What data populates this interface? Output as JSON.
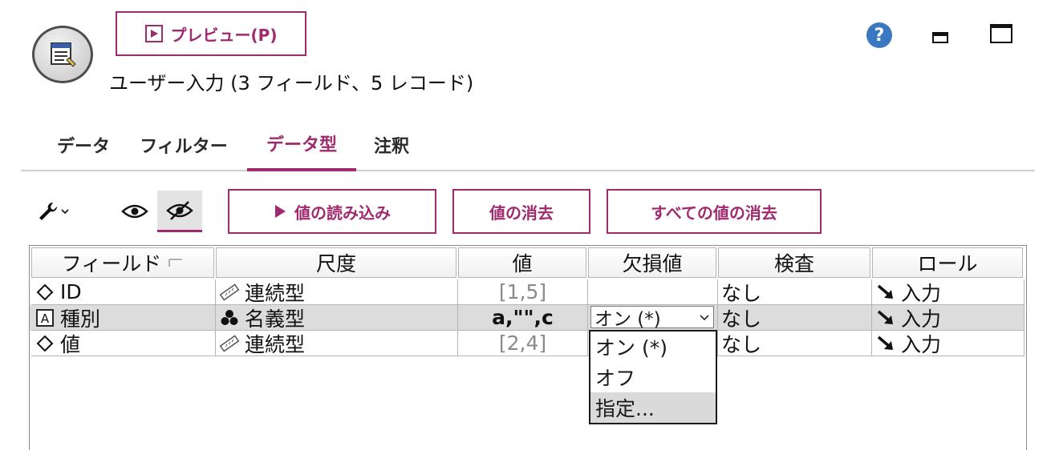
{
  "header": {
    "preview_label": "プレビュー(P)",
    "node_title": "ユーザー入力 (3 フィールド、5 レコード)",
    "help_glyph": "?"
  },
  "tabs": [
    {
      "label": "データ",
      "active": false
    },
    {
      "label": "フィルター",
      "active": false
    },
    {
      "label": "データ型",
      "active": true
    },
    {
      "label": "注釈",
      "active": false
    }
  ],
  "toolbar": {
    "read_values_label": "値の読み込み",
    "clear_values_label": "値の消去",
    "clear_all_values_label": "すべての値の消去"
  },
  "table": {
    "columns": [
      "フィールド",
      "尺度",
      "値",
      "欠損値",
      "検査",
      "ロール"
    ],
    "rows": [
      {
        "field": "ID",
        "field_icon": "continuous-diamond-icon",
        "measure": "連続型",
        "measure_icon": "ruler-icon",
        "values": "[1,5]",
        "missing": "",
        "check": "なし",
        "role": "入力"
      },
      {
        "field": "種別",
        "field_icon": "string-a-icon",
        "measure": "名義型",
        "measure_icon": "nominal-dots-icon",
        "values": "a,\"\",c",
        "missing": "オン (*)",
        "check": "なし",
        "role": "入力"
      },
      {
        "field": "値",
        "field_icon": "continuous-diamond-icon",
        "measure": "連続型",
        "measure_icon": "ruler-icon",
        "values": "[2,4]",
        "missing": "",
        "check": "なし",
        "role": "入力"
      }
    ]
  },
  "missing_dropdown": {
    "selected": "オン (*)",
    "options": [
      "オン (*)",
      "オフ",
      "指定..."
    ],
    "highlighted": "指定..."
  },
  "colors": {
    "accent": "#a02a6e",
    "selected_row": "#dcdcdc",
    "help_blue": "#3b78c2"
  }
}
